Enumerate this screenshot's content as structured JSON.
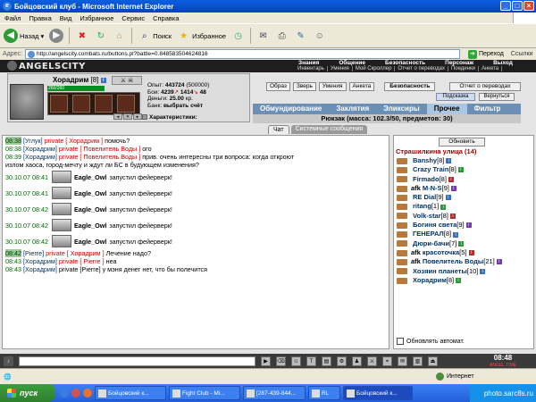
{
  "window": {
    "title": "Бойцовский клуб - Microsoft Internet Explorer"
  },
  "menu": [
    "Файл",
    "Правка",
    "Вид",
    "Избранное",
    "Сервис",
    "Справка"
  ],
  "toolbar": {
    "back": "Назад",
    "search": "Поиск",
    "favorites": "Избранное"
  },
  "address": {
    "label": "Адрес:",
    "url": "http://angelscity.combats.ru/buttons.pl?battle=0.848583504624816",
    "go": "Переход",
    "links": "Ссылки"
  },
  "site": {
    "logo": "ANGELSCITY",
    "nav1": [
      "Знания",
      "Общение",
      "Безопасность",
      "Персонаж",
      "Выход"
    ],
    "nav2": [
      "Инвентарь",
      "Умения",
      "Мой Скроллер",
      "Отчет о переводах",
      "Поединки",
      "Анкета"
    ]
  },
  "character": {
    "name": "Хорадрим",
    "level": "[8]",
    "hp": "260/260",
    "stats": {
      "exp_label": "Опыт:",
      "exp": "443724",
      "exp_next": "(500000)",
      "wins_label": "Бои:",
      "wins": "4239",
      "wins2": "1414",
      "wins3": "48",
      "money_label": "Деньги:",
      "money": "25.00",
      "money_unit": "кр.",
      "bank_label": "Банк:",
      "bank": "выбрать счёт"
    },
    "characteristics": "Характеристики:"
  },
  "buttons": {
    "obraz": "Образ",
    "zver": "Зверь",
    "umeniya": "Умения",
    "anketa": "Анкета",
    "security": "Безопасность",
    "transfers": "Отчет о переводах",
    "hint": "Подсказка",
    "return": "Вернуться"
  },
  "inventory_tabs": [
    {
      "label": "Обмундирование",
      "active": false
    },
    {
      "label": "Заклятия",
      "active": false
    },
    {
      "label": "Эликсиры",
      "active": false
    },
    {
      "label": "Прочее",
      "active": true
    },
    {
      "label": "Фильтр",
      "active": false
    }
  ],
  "rucksack": "Рюкзак (масса: 102.3/50, предметов: 30)",
  "chat_tabs": [
    {
      "label": "Чат",
      "active": true
    },
    {
      "label": "Системные сообщения",
      "active": false
    }
  ],
  "chat": [
    {
      "type": "msg",
      "time": "08:38",
      "hl": true,
      "from": "[Углук]",
      "priv": "private [ Хорадрим ]",
      "text": "помочь?"
    },
    {
      "type": "msg",
      "time": "08:38",
      "hl": false,
      "from": "[Хорадрим]",
      "priv": "private [ Повелитель Воды ]",
      "text": "ого"
    },
    {
      "type": "msg",
      "time": "08:39",
      "hl": false,
      "from": "[Хорадрим]",
      "priv": "private [ Повелитель Воды ]",
      "text": "прив. очень интересны три вопроса: когда откроют"
    },
    {
      "type": "cont",
      "text": "излом хаоса, город-мечту и ждут ли БС в будующем изменения?"
    },
    {
      "type": "fw",
      "time": "30.10.07 08:41",
      "who": "Eagle_Owl",
      "text": "запустил фейерверк!"
    },
    {
      "type": "fw",
      "time": "30.10.07 08:41",
      "who": "Eagle_Owl",
      "text": "запустил фейерверк!"
    },
    {
      "type": "fw",
      "time": "30.10.07 08:42",
      "who": "Eagle_Owl",
      "text": "запустил фейерверк!"
    },
    {
      "type": "fw",
      "time": "30.10.07 08:42",
      "who": "Eagle_Owl",
      "text": "запустил фейерверк!"
    },
    {
      "type": "fw",
      "time": "30.10.07 08:42",
      "who": "Eagle_Owl",
      "text": "запустил фейерверк!"
    },
    {
      "type": "msg",
      "time": "08:42",
      "hl": true,
      "from": "[Pierre]",
      "priv": "private [ Хорадрим ]",
      "text": "Лечение надо?"
    },
    {
      "type": "msg",
      "time": "08:43",
      "hl": false,
      "from": "[Хорадрим]",
      "priv": "private [ Pierre ]",
      "text": "неа"
    },
    {
      "type": "msg",
      "time": "08:43",
      "hl": false,
      "from": "[Хорадрим]",
      "priv": "",
      "text": "private [Pierre] у мэня денег нет, что бы полечится"
    }
  ],
  "room": {
    "refresh": "Обновить",
    "title": "Страшилкина улица (14)",
    "auto": "Обновлять автомат."
  },
  "players": [
    {
      "afk": "",
      "name": "Banshy",
      "level": "[8]"
    },
    {
      "afk": "",
      "name": "Crazy Train",
      "level": "[8]"
    },
    {
      "afk": "",
      "name": "Firmado",
      "level": "[8]"
    },
    {
      "afk": "afk",
      "name": "M-N-S",
      "level": "[9]"
    },
    {
      "afk": "",
      "name": "RE Dial",
      "level": "[9]"
    },
    {
      "afk": "",
      "name": "ritang",
      "level": "[1]"
    },
    {
      "afk": "",
      "name": "Volk-star",
      "level": "[8]"
    },
    {
      "afk": "",
      "name": "Богиня света",
      "level": "[9]"
    },
    {
      "afk": "",
      "name": "ГЕНЕРАЛ",
      "level": "[8]"
    },
    {
      "afk": "",
      "name": "Дюри-бачи",
      "level": "[7]"
    },
    {
      "afk": "afk",
      "name": "красоточка",
      "level": "[5]"
    },
    {
      "afk": "afk",
      "name": "Повелитель Воды",
      "level": "[21]"
    },
    {
      "afk": "",
      "name": "Хозяин планеты",
      "level": "[10]"
    },
    {
      "afk": "",
      "name": "Хорадрим",
      "level": "[8]"
    }
  ],
  "clock": {
    "time": "08:48",
    "tag": "ANGEL TIME"
  },
  "status": {
    "zone": "Интернет"
  },
  "taskbar": {
    "start": "пуск",
    "tasks": [
      "Бойцовский к...",
      "Fight Club - Mi...",
      "[287-439-844...",
      "RL",
      "Бойцовский к..."
    ],
    "tray": "photo.sarc8s.ru"
  },
  "colors": {
    "title": "#0842b8",
    "taskbar": "#245edb",
    "tabs": "#6b8fb5",
    "private": "#cc0000",
    "roomtitle": "#990000"
  }
}
